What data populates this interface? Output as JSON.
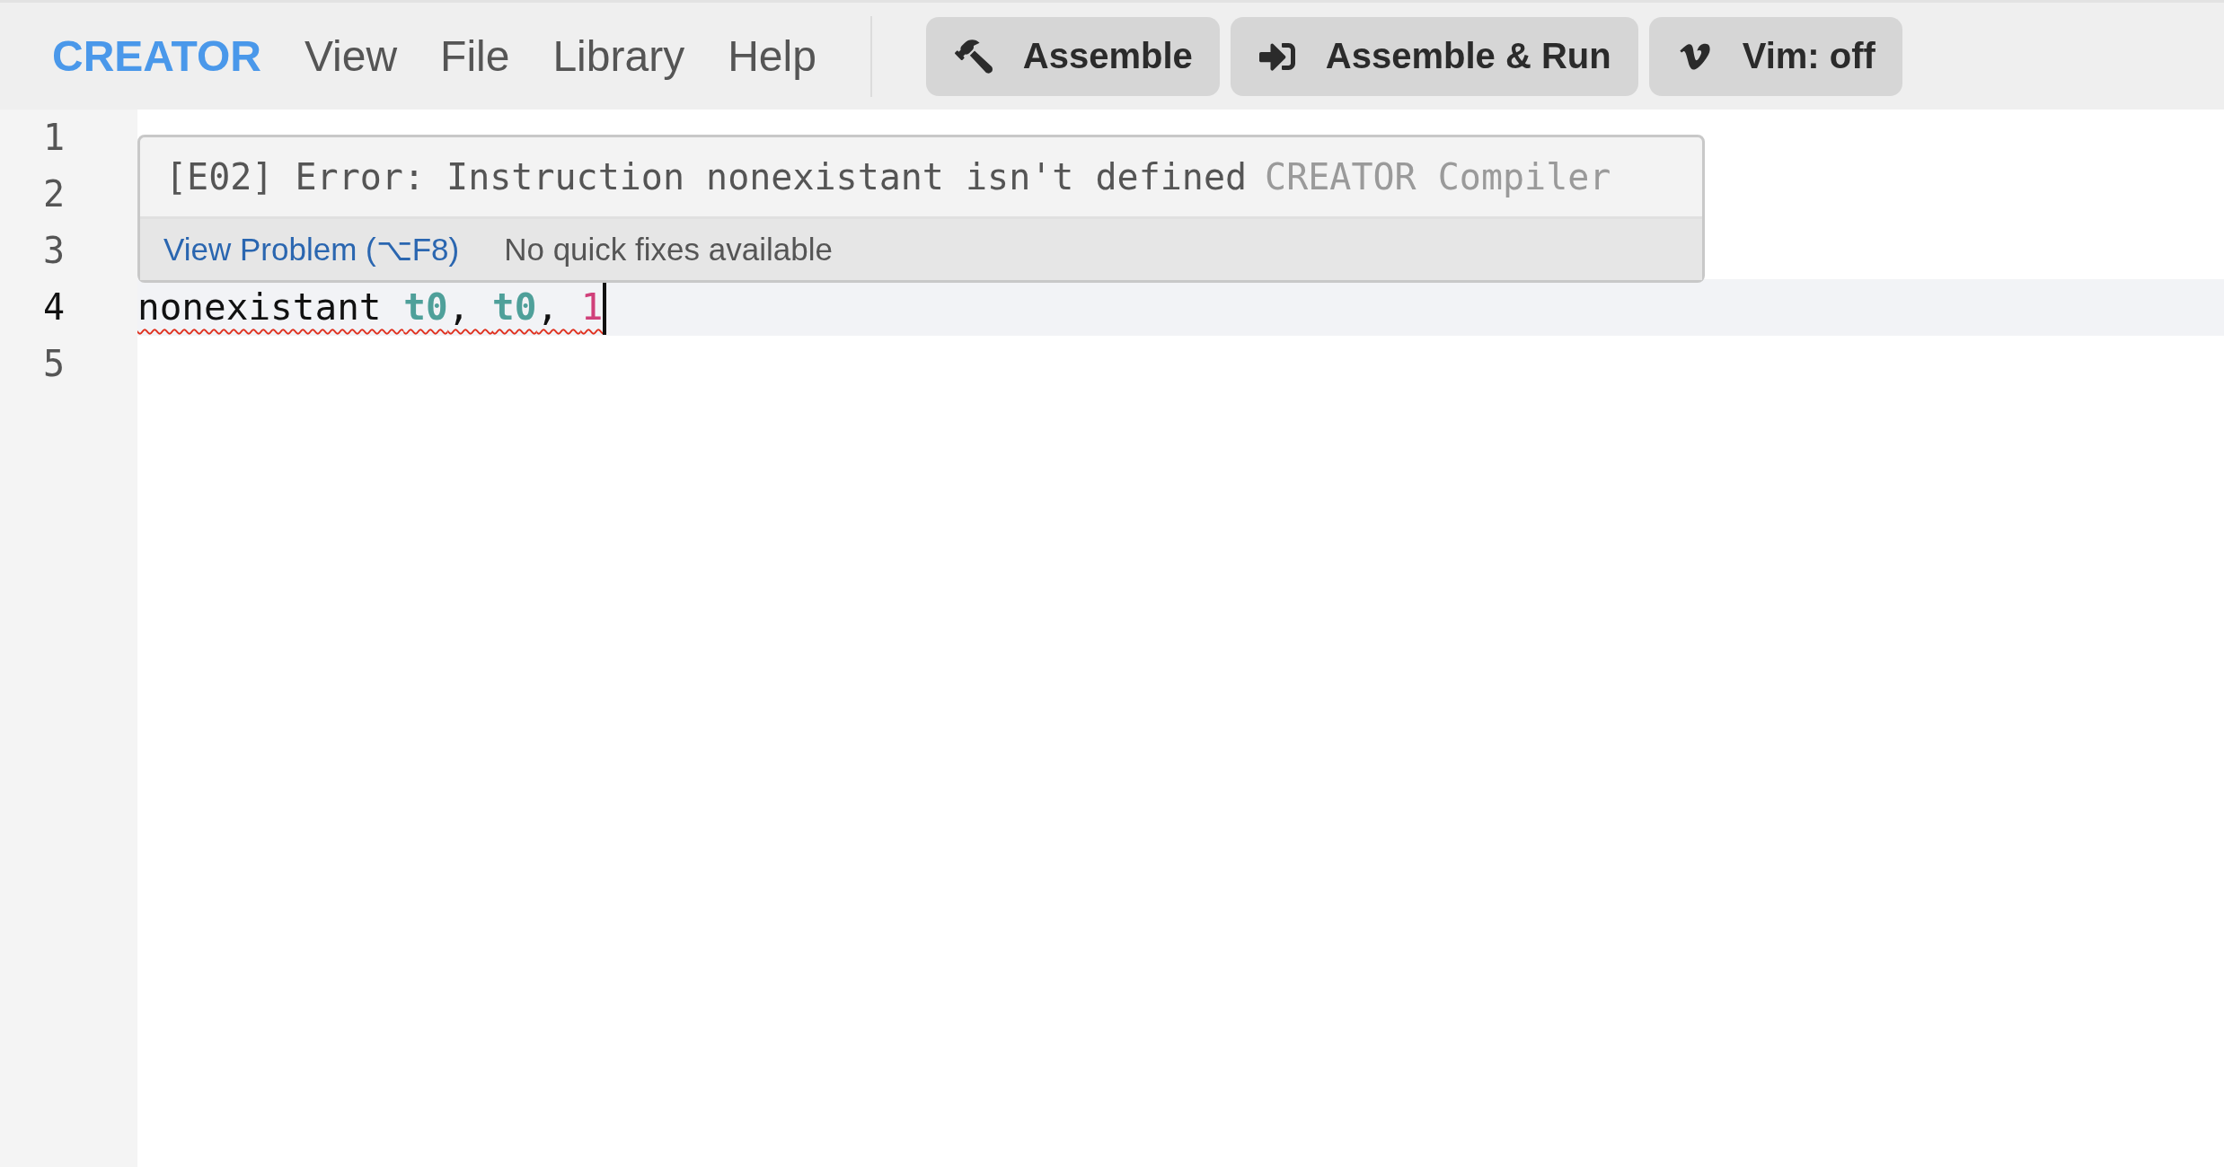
{
  "menu": {
    "logo": "CREATOR",
    "items": [
      "View",
      "File",
      "Library",
      "Help"
    ]
  },
  "toolbar": [
    {
      "kind": "assemble",
      "label": "Assemble"
    },
    {
      "kind": "run",
      "label": "Assemble & Run"
    },
    {
      "kind": "vim",
      "label": "Vim: off"
    }
  ],
  "editor": {
    "lines": [
      {
        "number": "1",
        "current": false
      },
      {
        "number": "2",
        "current": false
      },
      {
        "number": "3",
        "current": false
      },
      {
        "number": "4",
        "current": true,
        "error": true,
        "tokens": [
          {
            "kind": "plain",
            "text": "nonexistant "
          },
          {
            "kind": "register",
            "text": "t0"
          },
          {
            "kind": "plain",
            "text": ", "
          },
          {
            "kind": "register",
            "text": "t0"
          },
          {
            "kind": "plain",
            "text": ", "
          },
          {
            "kind": "number",
            "text": "1"
          }
        ]
      },
      {
        "number": "5",
        "current": false
      }
    ],
    "hover": {
      "message": "[E02] Error: Instruction nonexistant isn't defined",
      "source": "CREATOR Compiler",
      "action": "View Problem (⌥F8)",
      "note": "No quick fixes available"
    }
  }
}
